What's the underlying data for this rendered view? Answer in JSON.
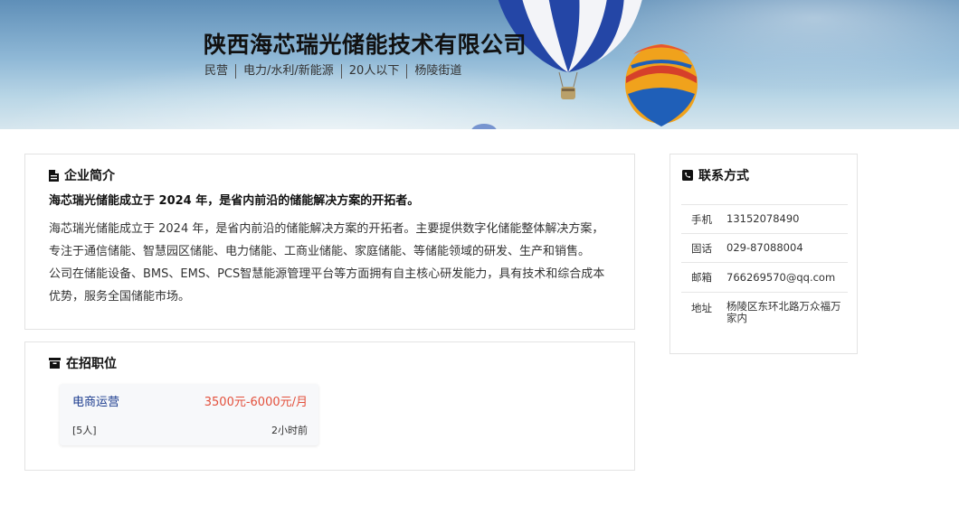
{
  "company": {
    "name": "陕西海芯瑞光储能技术有限公司",
    "tags": [
      "民营",
      "电力/水利/新能源",
      "20人以下",
      "杨陵街道"
    ]
  },
  "intro": {
    "heading": "企业简介",
    "summary": "海芯瑞光储能成立于 2024 年，是省内前沿的储能解决方案的开拓者。",
    "paragraph1": "海芯瑞光储能成立于 2024 年，是省内前沿的储能解决方案的开拓者。主要提供数字化储能整体解决方案，专注于通信储能、智慧园区储能、电力储能、工商业储能、家庭储能、等储能领域的研发、生产和销售。",
    "paragraph2": "公司在储能设备、BMS、EMS、PCS智慧能源管理平台等方面拥有自主核心研发能力，具有技术和综合成本优势，服务全国储能市场。"
  },
  "jobs": {
    "heading": "在招职位",
    "items": [
      {
        "title": "电商运营",
        "salary": "3500元-6000元/月",
        "count": "[5人]",
        "time": "2小时前"
      }
    ]
  },
  "contact": {
    "heading": "联系方式",
    "rows": [
      {
        "label": "手机",
        "value": "13152078490"
      },
      {
        "label": "固话",
        "value": "029-87088004"
      },
      {
        "label": "邮箱",
        "value": "766269570@qq.com"
      },
      {
        "label": "地址",
        "value": "杨陵区东环北路万众福万家内"
      }
    ]
  },
  "colors": {
    "accent_link": "#1d3d8f",
    "salary": "#e3503c"
  },
  "icons": {
    "intro": "document-icon",
    "jobs": "briefcase-icon",
    "contact": "phone-book-icon"
  }
}
